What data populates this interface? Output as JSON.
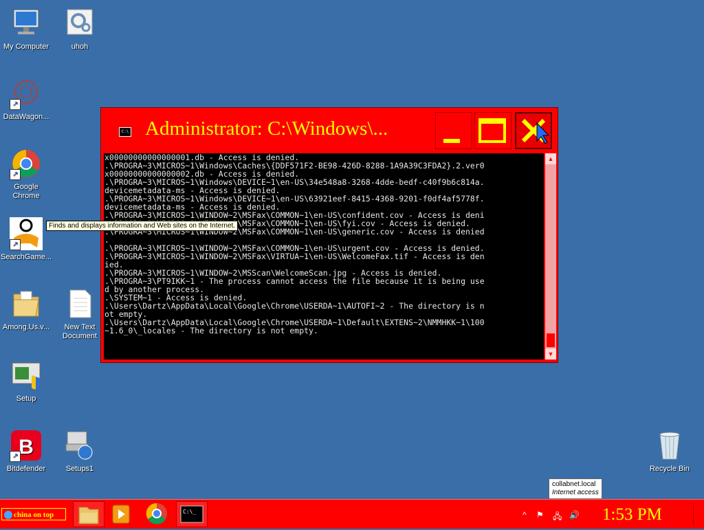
{
  "desktop": {
    "icons": [
      {
        "label": "My Computer"
      },
      {
        "label": "uhoh"
      },
      {
        "label": "DataWagon..."
      },
      {
        "label": "Google Chrome"
      },
      {
        "label": "SearchGame..."
      },
      {
        "label": "Among.Us.v..."
      },
      {
        "label": "New Text\nDocument"
      },
      {
        "label": "Setup"
      },
      {
        "label": "Bitdefender"
      },
      {
        "label": "Setups1"
      },
      {
        "label": "Recycle Bin"
      }
    ],
    "tooltip": "Finds and displays information and Web sites on the Internet."
  },
  "cmd_window": {
    "title": "Administrator: C:\\Windows\\...",
    "app_icon_text": "C:\\",
    "lines": [
      "x00000000000000001.db - Access is denied.",
      ".\\PROGRA~3\\MICROS~1\\Windows\\Caches\\{DDF571F2-BE98-426D-8288-1A9A39C3FDA2}.2.ver0",
      "x00000000000000002.db - Access is denied.",
      ".\\PROGRA~3\\MICROS~1\\Windows\\DEVICE~1\\en-US\\34e548a8-3268-4dde-bedf-c40f9b6c814a.",
      "devicemetadata-ms - Access is denied.",
      ".\\PROGRA~3\\MICROS~1\\Windows\\DEVICE~1\\en-US\\63921eef-8415-4368-9201-f0df4af5778f.",
      "devicemetadata-ms - Access is denied.",
      ".\\PROGRA~3\\MICROS~1\\WINDOW~2\\MSFax\\COMMON~1\\en-US\\confident.cov - Access is deni",
      "",
      ".\\PROGRA~3\\MICROS~1\\WINDOW~2\\MSFax\\COMMON~1\\en-US\\fyi.cov - Access is denied.",
      ".\\PROGRA~3\\MICROS~1\\WINDOW~2\\MSFax\\COMMON~1\\en-US\\generic.cov - Access is denied",
      ".",
      ".\\PROGRA~3\\MICROS~1\\WINDOW~2\\MSFax\\COMMON~1\\en-US\\urgent.cov - Access is denied.",
      "",
      ".\\PROGRA~3\\MICROS~1\\WINDOW~2\\MSFax\\VIRTUA~1\\en-US\\WelcomeFax.tif - Access is den",
      "ied.",
      ".\\PROGRA~3\\MICROS~1\\WINDOW~2\\MSScan\\WelcomeScan.jpg - Access is denied.",
      ".\\PROGRA~3\\PT9IKK~1 - The process cannot access the file because it is being use",
      "d by another process.",
      ".\\SYSTEM~1 - Access is denied.",
      ".\\Users\\Dartz\\AppData\\Local\\Google\\Chrome\\USERDA~1\\AUTOFI~2 - The directory is n",
      "ot empty.",
      ".\\Users\\Dartz\\AppData\\Local\\Google\\Chrome\\USERDA~1\\Default\\EXTENS~2\\NMMHKK~1\\100",
      "~1.6_0\\_locales - The directory is not empty."
    ]
  },
  "taskbar": {
    "start_label": "china on top",
    "clock": "1:53 PM",
    "network_tooltip": {
      "line1": "collabnet.local",
      "line2": "Internet access"
    },
    "tray_expand": "^"
  }
}
